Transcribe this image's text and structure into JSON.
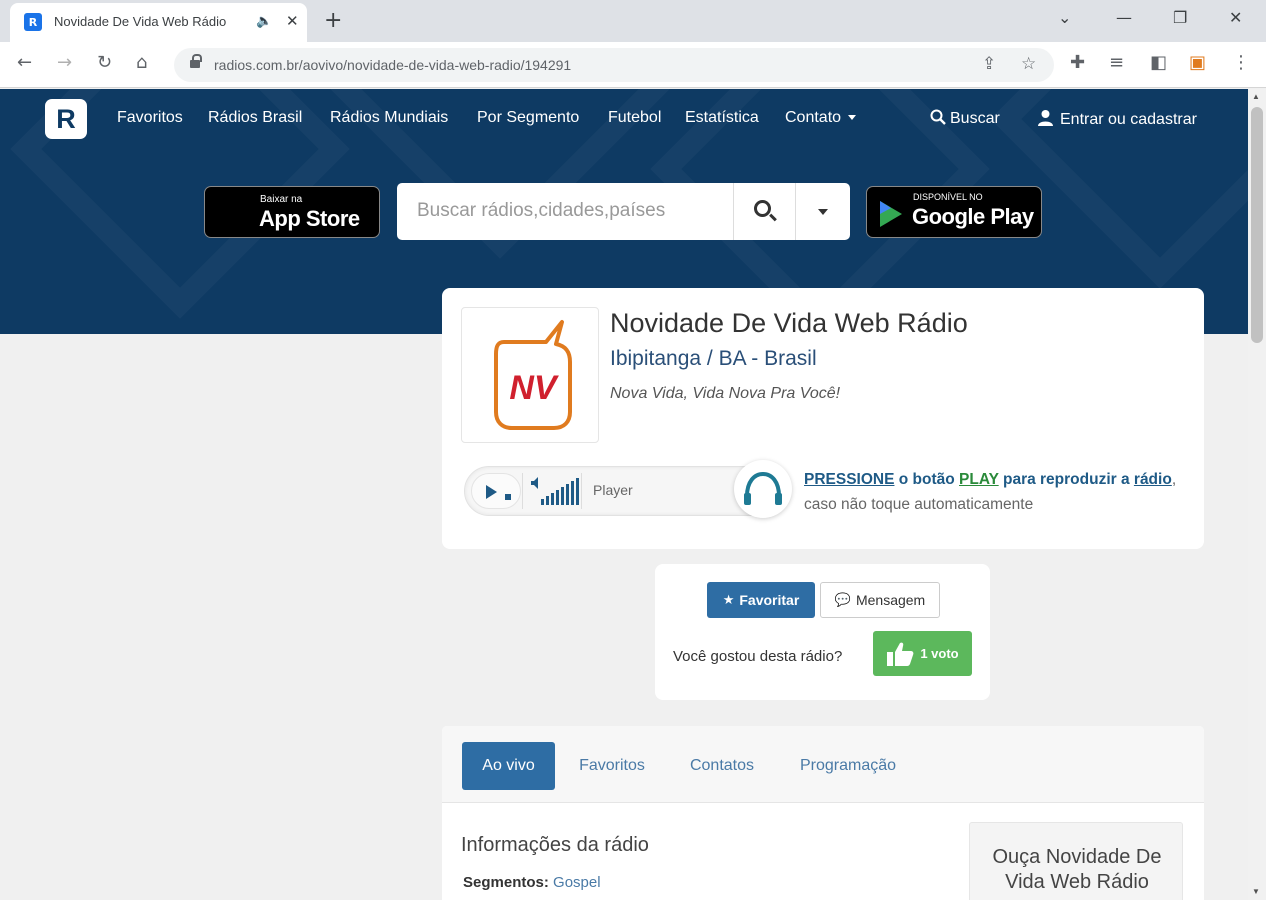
{
  "browser": {
    "tab_title": "Novidade De Vida Web Rádio",
    "favicon_letter": "R",
    "url": "radios.com.br/aovivo/novidade-de-vida-web-radio/194291"
  },
  "site": {
    "logo_letter": "R",
    "nav": {
      "favoritos": "Favoritos",
      "radios_brasil": "Rádios Brasil",
      "radios_mundiais": "Rádios Mundiais",
      "por_segmento": "Por Segmento",
      "futebol": "Futebol",
      "estatistica": "Estatística",
      "contato": "Contato",
      "buscar": "Buscar",
      "entrar": "Entrar ou cadastrar"
    },
    "appstore": {
      "small": "Baixar na",
      "big": "App Store"
    },
    "googleplay": {
      "small": "DISPONÍVEL NO",
      "big": "Google Play"
    },
    "search": {
      "placeholder": "Buscar rádios,cidades,países"
    }
  },
  "station": {
    "logo_text": "NV",
    "name": "Novidade De Vida Web Rádio",
    "location": "Ibipitanga / BA - Brasil",
    "slogan": "Nova Vida, Vida Nova Pra Você!",
    "player_label": "Player",
    "note": {
      "pressione": "PRESSIONE",
      "o_botao": " o botão ",
      "play": "PLAY",
      "para": " para reproduzir a ",
      "radio": "rádio",
      "caso": ", caso não toque automaticamente"
    }
  },
  "actions": {
    "favoritar": "Favoritar",
    "mensagem": "Mensagem",
    "like_question": "Você gostou desta rádio?",
    "vote": "1 voto"
  },
  "info": {
    "tabs": [
      "Ao vivo",
      "Favoritos",
      "Contatos",
      "Programação"
    ],
    "title": "Informações da rádio",
    "segmentos_label": "Segmentos:",
    "segmentos_value": "Gospel",
    "listen": "Ouça Novidade De Vida Web Rádio"
  },
  "colors": {
    "hero": "#0e3a63",
    "primary": "#2e6da4",
    "success": "#5cb85c",
    "logo_orange": "#e07b1f",
    "logo_red": "#d0202e"
  }
}
